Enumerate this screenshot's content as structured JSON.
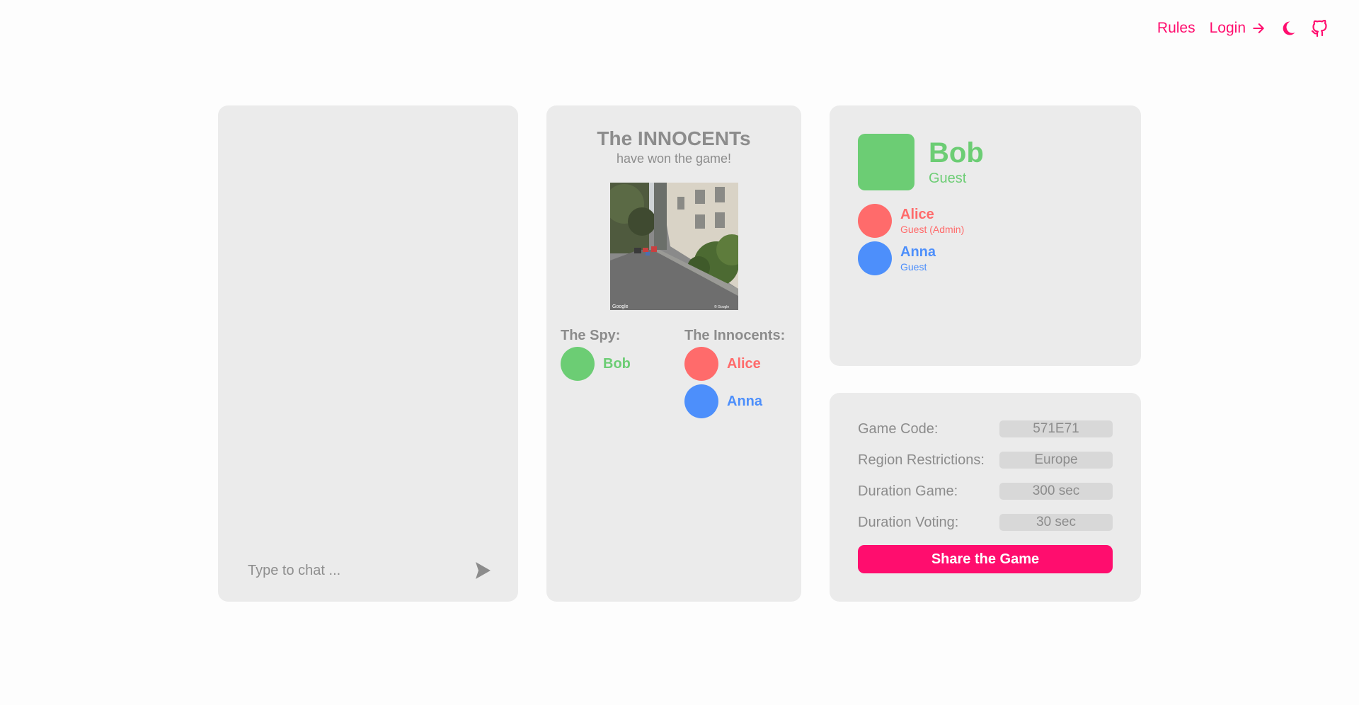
{
  "nav": {
    "rules_label": "Rules",
    "login_label": "Login",
    "login_icon": "arrow-right-icon",
    "theme_icon": "moon-icon",
    "github_icon": "github-icon"
  },
  "colors": {
    "accent": "#ff0d6e",
    "green": "#6ccd74",
    "red": "#ff6b6b",
    "blue": "#4d8ffb",
    "card": "#ebebeb"
  },
  "chat": {
    "placeholder": "Type to chat ...",
    "send_icon": "send-icon"
  },
  "result": {
    "title": "The INNOCENTs",
    "subtitle": "have won the game!",
    "spy_heading": "The Spy:",
    "spy": {
      "name": "Bob",
      "color": "#6ccd74"
    },
    "innocents_heading": "The Innocents:",
    "innocents": [
      {
        "name": "Alice",
        "color": "#ff6b6b"
      },
      {
        "name": "Anna",
        "color": "#4d8ffb"
      }
    ],
    "image_watermark_left": "Google",
    "image_watermark_right": "© Google"
  },
  "players": {
    "me": {
      "name": "Bob",
      "role": "Guest",
      "color": "#6ccd74"
    },
    "others": [
      {
        "name": "Alice",
        "role": "Guest (Admin)",
        "color": "#ff6b6b"
      },
      {
        "name": "Anna",
        "role": "Guest",
        "color": "#4d8ffb"
      }
    ]
  },
  "settings": {
    "rows": [
      {
        "label": "Game Code:",
        "value": "571E71"
      },
      {
        "label": "Region Restrictions:",
        "value": "Europe"
      },
      {
        "label": "Duration Game:",
        "value": "300 sec"
      },
      {
        "label": "Duration Voting:",
        "value": "30 sec"
      }
    ],
    "share_label": "Share the Game"
  }
}
